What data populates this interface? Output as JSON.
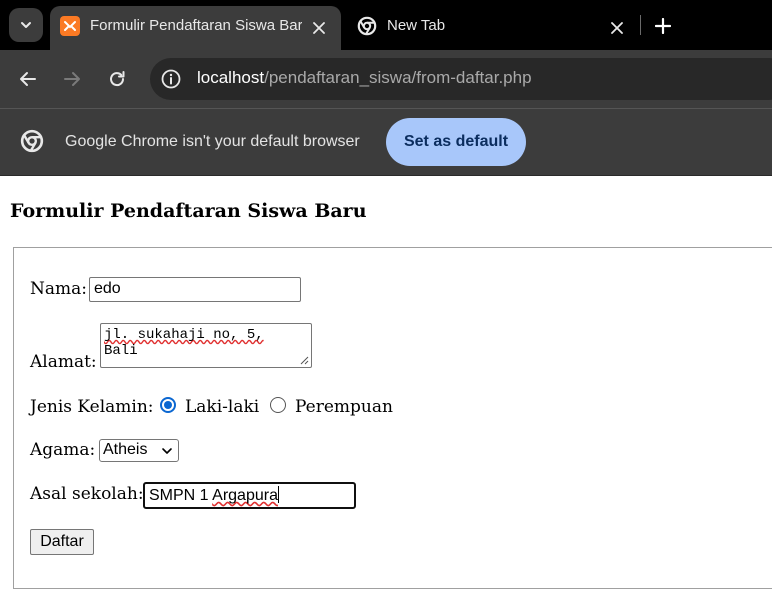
{
  "browser": {
    "tabs": [
      {
        "title": "Formulir Pendaftaran Siswa Baru",
        "active": true,
        "favicon": "xampp-icon"
      },
      {
        "title": "New Tab",
        "active": false,
        "favicon": "chrome-icon"
      }
    ],
    "address_bar": {
      "host": "localhost",
      "path": "/pendaftaran_siswa/from-daftar.php"
    },
    "infobar": {
      "message": "Google Chrome isn't your default browser",
      "button_label": "Set as default"
    },
    "colors": {
      "tabstrip_bg": "#000000",
      "toolbar_bg": "#3c3c3c",
      "infobar_button_bg": "#a8c7fa",
      "radio_checked": "#0b67d1"
    }
  },
  "page": {
    "title": "Formulir Pendaftaran Siswa Baru",
    "form": {
      "nama": {
        "label": "Nama:",
        "value": "edo"
      },
      "alamat": {
        "label": "Alamat:",
        "line1": "jl. sukahaji no, 5,",
        "line2": "Bali"
      },
      "jenis_kelamin": {
        "label": "Jenis Kelamin:",
        "options": [
          {
            "label": "Laki-laki",
            "checked": true
          },
          {
            "label": "Perempuan",
            "checked": false
          }
        ]
      },
      "agama": {
        "label": "Agama:",
        "selected": "Atheis"
      },
      "asal_sekolah": {
        "label": "Asal sekolah:",
        "value": "SMPN 1 Argapura"
      },
      "submit_label": "Daftar"
    }
  }
}
